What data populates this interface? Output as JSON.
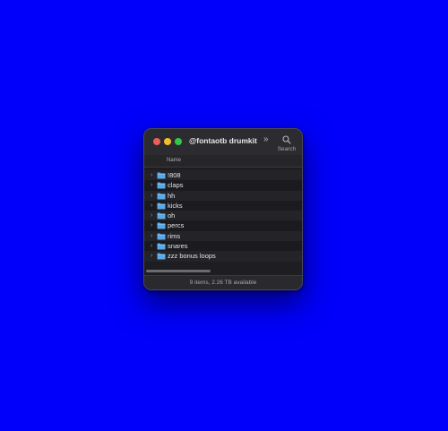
{
  "colors": {
    "desktop": "#0000fb",
    "window_bg": "#1e1e22",
    "folder_blue": "#5aa8e8",
    "close": "#ee5f57",
    "minimize": "#f4bd2f",
    "maximize": "#33c748"
  },
  "window": {
    "title": "@fontaotb drumkit",
    "overflow_glyph": "»",
    "search_label": "Search",
    "search_icon": "magnifier-icon"
  },
  "list": {
    "column_name": "Name",
    "items": [
      {
        "name": "!808",
        "icon": "folder-icon"
      },
      {
        "name": "claps",
        "icon": "folder-icon"
      },
      {
        "name": "hh",
        "icon": "folder-icon"
      },
      {
        "name": "kicks",
        "icon": "folder-icon"
      },
      {
        "name": "oh",
        "icon": "folder-icon"
      },
      {
        "name": "percs",
        "icon": "folder-icon"
      },
      {
        "name": "rims",
        "icon": "folder-icon"
      },
      {
        "name": "snares",
        "icon": "folder-icon"
      },
      {
        "name": "zzz bonus loops",
        "icon": "folder-icon"
      }
    ]
  },
  "status": {
    "text": "9 items, 2.26 TB available"
  }
}
